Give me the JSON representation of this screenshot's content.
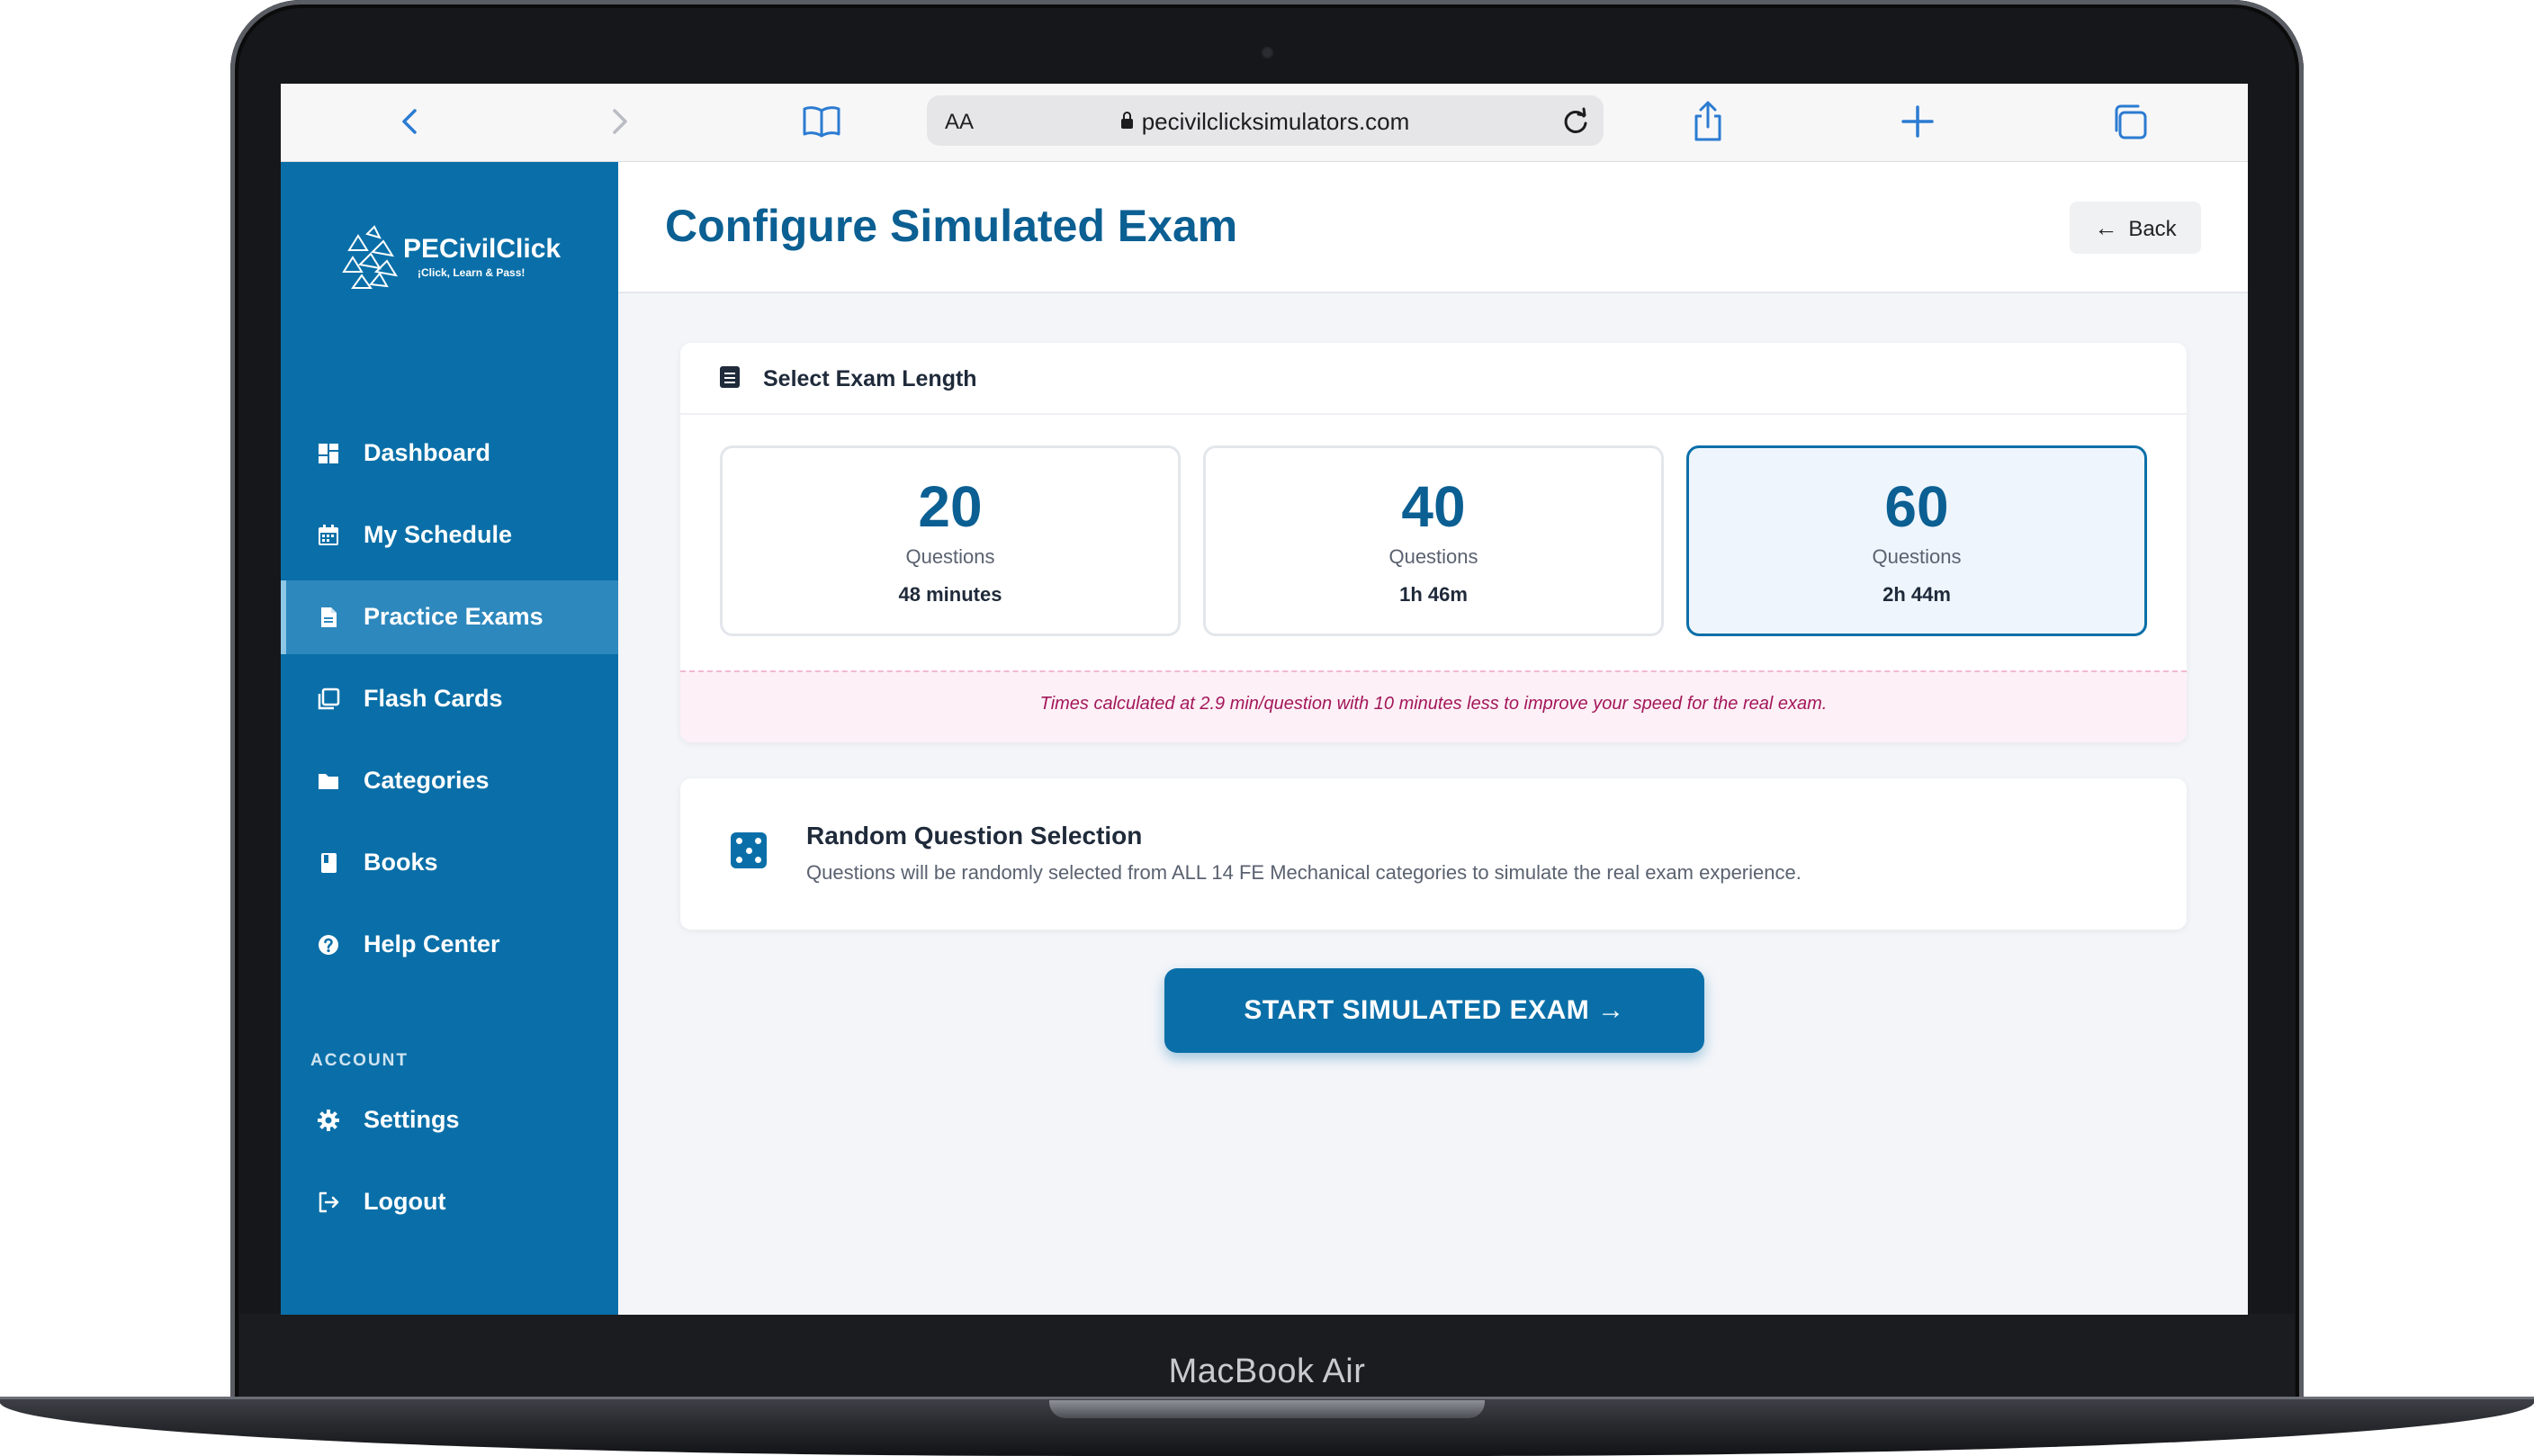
{
  "device": {
    "brand": "MacBook Air"
  },
  "browser": {
    "text_size_label": "AA",
    "url": "pecivilclicksimulators.com",
    "icons": [
      "back-icon",
      "forward-icon",
      "bookmarks-icon",
      "lock-icon",
      "reload-icon",
      "share-icon",
      "new-tab-icon",
      "tabs-icon"
    ]
  },
  "sidebar": {
    "logo_title": "PECivilClick",
    "logo_subtitle": "¡Click, Learn & Pass!",
    "items": [
      {
        "label": "Dashboard",
        "icon": "dashboard-icon"
      },
      {
        "label": "My Schedule",
        "icon": "calendar-icon"
      },
      {
        "label": "Practice Exams",
        "icon": "document-icon",
        "active": true
      },
      {
        "label": "Flash Cards",
        "icon": "cards-icon"
      },
      {
        "label": "Categories",
        "icon": "folder-icon"
      },
      {
        "label": "Books",
        "icon": "book-icon"
      },
      {
        "label": "Help Center",
        "icon": "help-icon"
      }
    ],
    "account_label": "ACCOUNT",
    "account_items": [
      {
        "label": "Settings",
        "icon": "gear-icon"
      },
      {
        "label": "Logout",
        "icon": "logout-icon"
      }
    ],
    "colors": {
      "background": "#0a6fa8",
      "active": "#2d88bd"
    }
  },
  "header": {
    "title": "Configure Simulated Exam",
    "back_label": "Back"
  },
  "exam_length": {
    "title": "Select Exam Length",
    "options": [
      {
        "count": "20",
        "unit": "Questions",
        "time": "48 minutes",
        "selected": false
      },
      {
        "count": "40",
        "unit": "Questions",
        "time": "1h 46m",
        "selected": false
      },
      {
        "count": "60",
        "unit": "Questions",
        "time": "2h 44m",
        "selected": true
      }
    ],
    "note": "Times calculated at 2.9 min/question with 10 minutes less to improve your speed for the real exam."
  },
  "random": {
    "title": "Random Question Selection",
    "description": "Questions will be randomly selected from ALL 14 FE Mechanical categories to simulate the real exam experience."
  },
  "start_label": "START SIMULATED EXAM →",
  "accent_color": "#0a6fa8"
}
